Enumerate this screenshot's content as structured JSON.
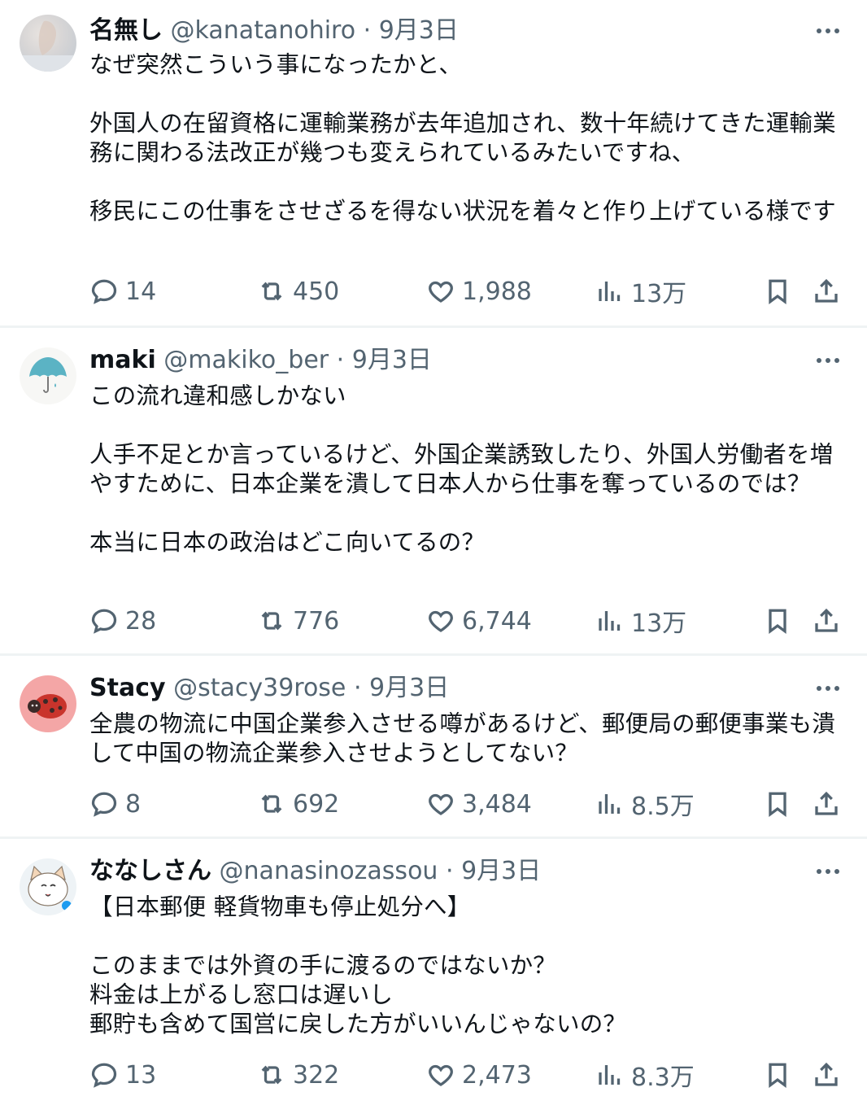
{
  "tweets": [
    {
      "name": "名無し",
      "handle": "@kanatanohiro",
      "separator": "·",
      "date": "9月3日",
      "avatar": "avatar-photo-blurry",
      "text": "なぜ突然こういう事になったかと、\n\n外国人の在留資格に運輸業務が去年追加され、数十年続けてきた運輸業務に関わる法改正が幾つも変えられているみたいですね、\n\n移民にこの仕事をさせざるを得ない状況を着々と作り上げている様です",
      "replies": "14",
      "reposts": "450",
      "likes": "1,988",
      "views": "13万"
    },
    {
      "name": "maki",
      "handle": "@makiko_ber",
      "separator": "·",
      "date": "9月3日",
      "avatar": "umbrella-avatar",
      "text": "この流れ違和感しかない\n\n人手不足とか言っているけど、外国企業誘致したり、外国人労働者を増やすために、日本企業を潰して日本人から仕事を奪っているのでは？\n\n本当に日本の政治はどこ向いてるの？",
      "replies": "28",
      "reposts": "776",
      "likes": "6,744",
      "views": "13万"
    },
    {
      "name": "Stacy",
      "handle": "@stacy39rose",
      "separator": "·",
      "date": "9月3日",
      "avatar": "ladybug-avatar",
      "text": "全農の物流に中国企業参入させる噂があるけど、郵便局の郵便事業も潰して中国の物流企業参入させようとしてない？",
      "replies": "8",
      "reposts": "692",
      "likes": "3,484",
      "views": "8.5万"
    },
    {
      "name": "ななしさん",
      "handle": "@nanasinozassou",
      "separator": "·",
      "date": "9月3日",
      "avatar": "cat-avatar",
      "text": "【日本郵便 軽貨物車も停止処分へ】\n\nこのままでは外資の手に渡るのではないか？\n料金は上がるし窓口は遅いし\n郵貯も含めて国営に戻した方がいいんじゃないの？",
      "replies": "13",
      "reposts": "322",
      "likes": "2,473",
      "views": "8.3万"
    }
  ],
  "colors": {
    "text": "#0f1419",
    "secondary": "#536471",
    "divider": "#eff3f4"
  }
}
